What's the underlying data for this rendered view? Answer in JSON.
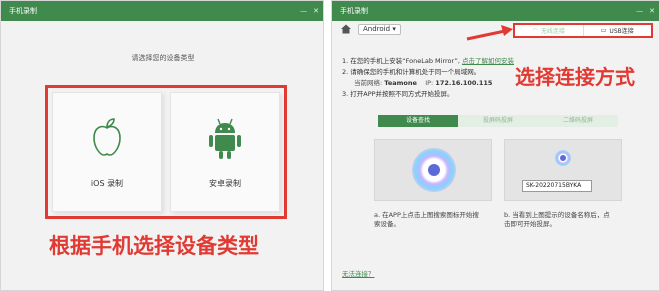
{
  "left_window": {
    "title": "手机录制",
    "subtitle": "请选择您的设备类型",
    "cards": [
      {
        "label": "iOS 录制",
        "icon": "apple-icon"
      },
      {
        "label": "安卓录制",
        "icon": "android-icon"
      }
    ],
    "callout": "根据手机选择设备类型"
  },
  "right_window": {
    "title": "手机录制",
    "os_select": "Android",
    "connection_tabs": [
      {
        "label": "无线连接",
        "icon": "wifi-icon"
      },
      {
        "label": "USB连接",
        "icon": "usb-icon"
      }
    ],
    "callout": "选择连接方式",
    "steps": {
      "step1_text": "1. 在您的手机上安装“FoneLab Mirror”,",
      "step1_link": "点击了解如何安装",
      "step2_text": "2. 请确保您的手机和计算机处于同一个局域网。",
      "network_label": "当前网络:",
      "network_name": "Teamone",
      "ip_label": "IP:",
      "ip_value": "172.16.100.115",
      "step3_text": "3. 打开APP并按照不同方式开始投屏。"
    },
    "method_tabs": [
      "设备查找",
      "投屏码投屏",
      "二维码投屏"
    ],
    "device_name": "SK-20220715BYKA",
    "note_a": "a. 在APP上点击上图搜索图标开始搜索设备。",
    "note_b": "b. 当看到上图提示的设备名称后，点击即可开始投屏。",
    "footer_link": "无法连接？"
  },
  "colors": {
    "accent": "#3f8a4c",
    "callout": "#e03a32"
  }
}
